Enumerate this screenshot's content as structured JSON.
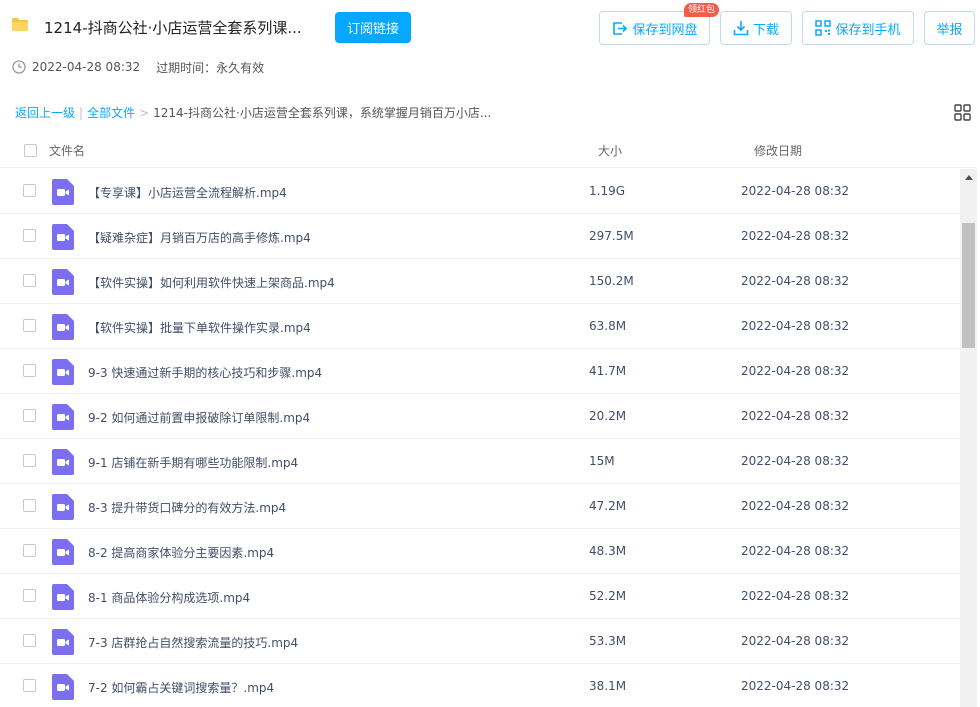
{
  "header": {
    "title": "1214-抖商公社·小店运营全套系列课...",
    "subscribe_label": "订阅链接",
    "save_to_cloud_label": "保存到网盘",
    "red_packet_badge": "领红包",
    "download_label": "下载",
    "save_to_phone_label": "保存到手机",
    "report_label": "举报"
  },
  "meta": {
    "shared_time": "2022-04-28 08:32",
    "expire": "过期时间：永久有效"
  },
  "breadcrumb": {
    "back": "返回上一级",
    "separator": "|",
    "all_files": "全部文件",
    "arrow": ">",
    "current": "1214-抖商公社·小店运营全套系列课，系统掌握月销百万小店..."
  },
  "columns": {
    "name": "文件名",
    "size": "大小",
    "date": "修改日期"
  },
  "files": [
    {
      "name": "【专享课】小店运营全流程解析.mp4",
      "size": "1.19G",
      "date": "2022-04-28 08:32"
    },
    {
      "name": "【疑难杂症】月销百万店的高手修炼.mp4",
      "size": "297.5M",
      "date": "2022-04-28 08:32"
    },
    {
      "name": "【软件实操】如何利用软件快速上架商品.mp4",
      "size": "150.2M",
      "date": "2022-04-28 08:32"
    },
    {
      "name": "【软件实操】批量下单软件操作实录.mp4",
      "size": "63.8M",
      "date": "2022-04-28 08:32"
    },
    {
      "name": "9-3 快速通过新手期的核心技巧和步骤.mp4",
      "size": "41.7M",
      "date": "2022-04-28 08:32"
    },
    {
      "name": "9-2 如何通过前置申报破除订单限制.mp4",
      "size": "20.2M",
      "date": "2022-04-28 08:32"
    },
    {
      "name": "9-1 店铺在新手期有哪些功能限制.mp4",
      "size": "15M",
      "date": "2022-04-28 08:32"
    },
    {
      "name": "8-3 提升带货口碑分的有效方法.mp4",
      "size": "47.2M",
      "date": "2022-04-28 08:32"
    },
    {
      "name": "8-2 提高商家体验分主要因素.mp4",
      "size": "48.3M",
      "date": "2022-04-28 08:32"
    },
    {
      "name": "8-1 商品体验分构成选项.mp4",
      "size": "52.2M",
      "date": "2022-04-28 08:32"
    },
    {
      "name": "7-3 店群抢占自然搜索流量的技巧.mp4",
      "size": "53.3M",
      "date": "2022-04-28 08:32"
    },
    {
      "name": "7-2 如何霸占关键词搜索量？.mp4",
      "size": "38.1M",
      "date": "2022-04-28 08:32"
    }
  ],
  "icons": {
    "folder": "folder-icon",
    "clock": "clock-icon",
    "video_file": "video-file-icon",
    "grid_view": "grid-view-icon"
  },
  "colors": {
    "accent": "#06a7ff",
    "video_icon": "#7b6ef0",
    "folder": "#f5c449",
    "badge": "#f25d48"
  }
}
